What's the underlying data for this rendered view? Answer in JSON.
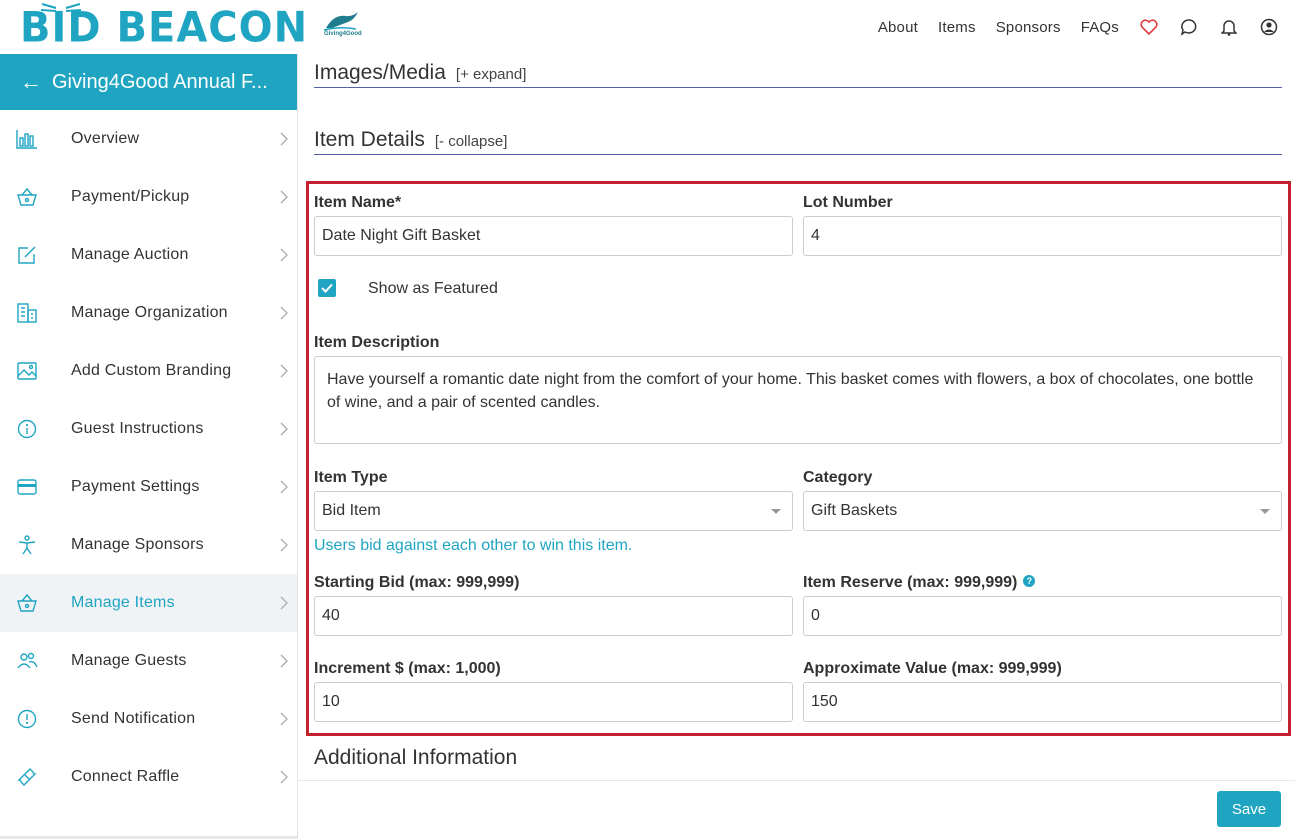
{
  "brand": {
    "logo_text": "BID BEACON",
    "org_logo_text": "Giving4Good",
    "accent": "#1fa5c2",
    "highlight": "#c4202f"
  },
  "topnav": {
    "links": [
      "About",
      "Items",
      "Sponsors",
      "FAQs"
    ],
    "icons": [
      "heart-icon",
      "chat-icon",
      "bell-icon",
      "account-icon"
    ]
  },
  "sidebar": {
    "event_title": "Giving4Good Annual F...",
    "items": [
      {
        "label": "Overview",
        "icon": "bar-chart-icon"
      },
      {
        "label": "Payment/Pickup",
        "icon": "basket-icon"
      },
      {
        "label": "Manage Auction",
        "icon": "edit-icon"
      },
      {
        "label": "Manage Organization",
        "icon": "building-icon"
      },
      {
        "label": "Add Custom Branding",
        "icon": "image-icon"
      },
      {
        "label": "Guest Instructions",
        "icon": "info-icon"
      },
      {
        "label": "Payment Settings",
        "icon": "credit-card-icon"
      },
      {
        "label": "Manage Sponsors",
        "icon": "person-icon"
      },
      {
        "label": "Manage Items",
        "icon": "basket-icon",
        "active": true
      },
      {
        "label": "Manage Guests",
        "icon": "users-icon"
      },
      {
        "label": "Send Notification",
        "icon": "alert-icon"
      },
      {
        "label": "Connect Raffle",
        "icon": "ticket-icon"
      }
    ]
  },
  "sections": {
    "images": {
      "title": "Images/Media",
      "toggle": "[+ expand]"
    },
    "details": {
      "title": "Item Details",
      "toggle": "[- collapse]"
    },
    "additional": {
      "title": "Additional Information"
    }
  },
  "form": {
    "item_name": {
      "label": "Item Name*",
      "value": "Date Night Gift Basket"
    },
    "lot_number": {
      "label": "Lot Number",
      "value": "4"
    },
    "featured": {
      "label": "Show as Featured",
      "checked": true
    },
    "description": {
      "label": "Item Description",
      "value": "Have yourself a romantic date night from the comfort of your home. This basket comes with flowers, a box of chocolates, one bottle of wine, and a pair of scented candles."
    },
    "item_type": {
      "label": "Item Type",
      "value": "Bid Item",
      "hint": "Users bid against each other to win this item."
    },
    "category": {
      "label": "Category",
      "value": "Gift Baskets"
    },
    "starting_bid": {
      "label": "Starting Bid (max: 999,999)",
      "value": "40"
    },
    "item_reserve": {
      "label": "Item Reserve (max: 999,999)",
      "value": "0",
      "help": "?"
    },
    "increment": {
      "label": "Increment $ (max: 1,000)",
      "value": "10"
    },
    "approx_value": {
      "label": "Approximate Value (max: 999,999)",
      "value": "150"
    }
  },
  "footer": {
    "save_label": "Save"
  }
}
